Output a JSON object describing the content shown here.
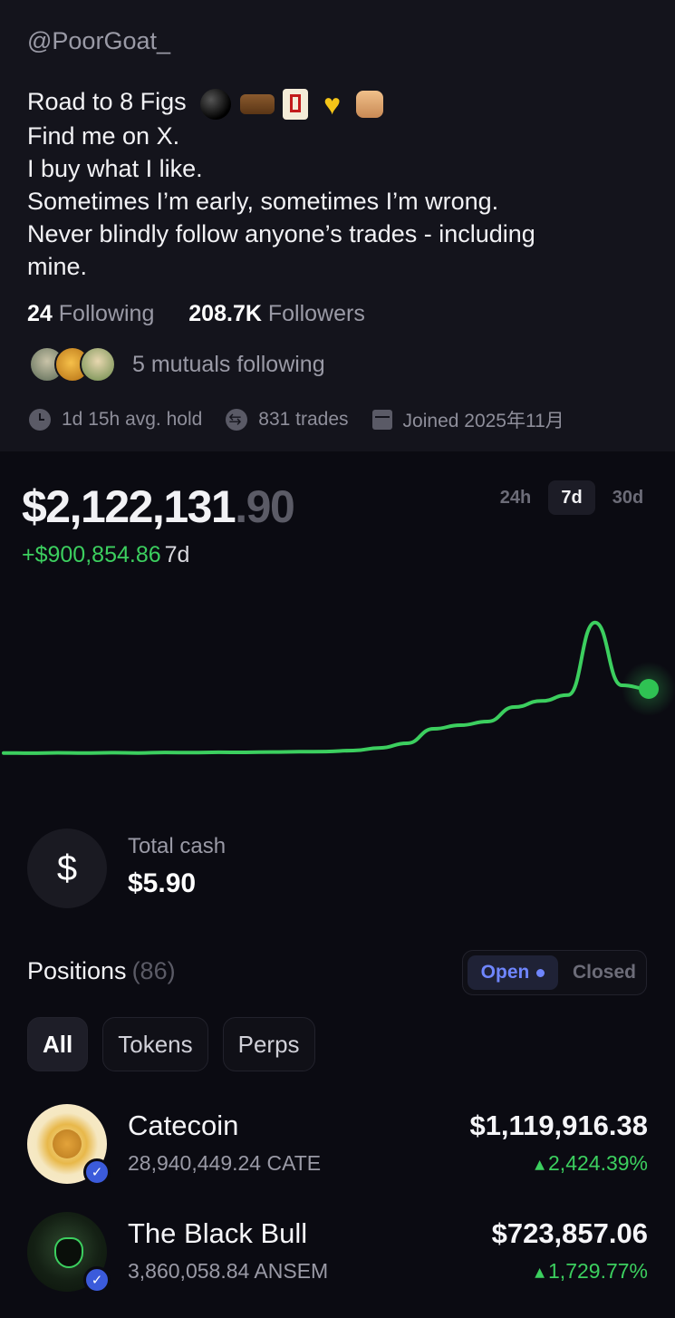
{
  "profile": {
    "handle": "@PoorGoat_",
    "bio_line1": "Road to 8 Figs",
    "bio_emojis": [
      "black-ball",
      "ox",
      "mahjong-red-dragon",
      "yellow-heart",
      "cat"
    ],
    "bio_line2": "Find me on X.",
    "bio_line3": "I buy what I like.",
    "bio_line4": "Sometimes I’m early, sometimes I’m wrong.",
    "bio_line5": "Never blindly follow anyone’s trades - including",
    "bio_line6": "mine.",
    "following_count": "24",
    "following_label": "Following",
    "followers_count": "208.7K",
    "followers_label": "Followers",
    "mutuals_text": "5 mutuals following",
    "avg_hold": "1d 15h avg. hold",
    "trades": "831 trades",
    "joined": "Joined 2025年11月"
  },
  "portfolio": {
    "balance_main": "$2,122,131",
    "balance_cents": ".90",
    "pnl": "+$900,854.86",
    "pnl_period": "7d",
    "ranges": [
      "24h",
      "7d",
      "30d"
    ],
    "active_range": "7d"
  },
  "chart_data": {
    "type": "line",
    "title": "",
    "xlabel": "",
    "ylabel": "",
    "series": [
      {
        "values": [
          1220000,
          1218000,
          1221000,
          1219000,
          1222000,
          1220000,
          1224000,
          1223000,
          1226000,
          1225000,
          1228000,
          1230000,
          1232000,
          1240000,
          1262000,
          1300000,
          1420000,
          1450000,
          1480000,
          1600000,
          1650000,
          1700000,
          2300000,
          1780000,
          1750000
        ]
      }
    ],
    "grid": false,
    "color": "#3ccf5f"
  },
  "cash": {
    "icon": "dollar-icon",
    "label": "Total cash",
    "value": "$5.90"
  },
  "positions": {
    "title": "Positions",
    "count": "(86)",
    "toggle_open": "Open",
    "toggle_closed": "Closed",
    "filters": [
      "All",
      "Tokens",
      "Perps"
    ],
    "active_filter": "All",
    "items": [
      {
        "name": "Catecoin",
        "amount": "28,940,449.24 CATE",
        "value": "$1,119,916.38",
        "change": "2,424.39%",
        "icon": "catecoin-icon"
      },
      {
        "name": "The Black Bull",
        "amount": "3,860,058.84 ANSEM",
        "value": "$723,857.06",
        "change": "1,729.77%",
        "icon": "black-bull-icon"
      }
    ]
  },
  "colors": {
    "background": "#0b0b12",
    "profile_bg": "#14141c",
    "gain": "#3ccf5f",
    "accent": "#6f86ff"
  }
}
